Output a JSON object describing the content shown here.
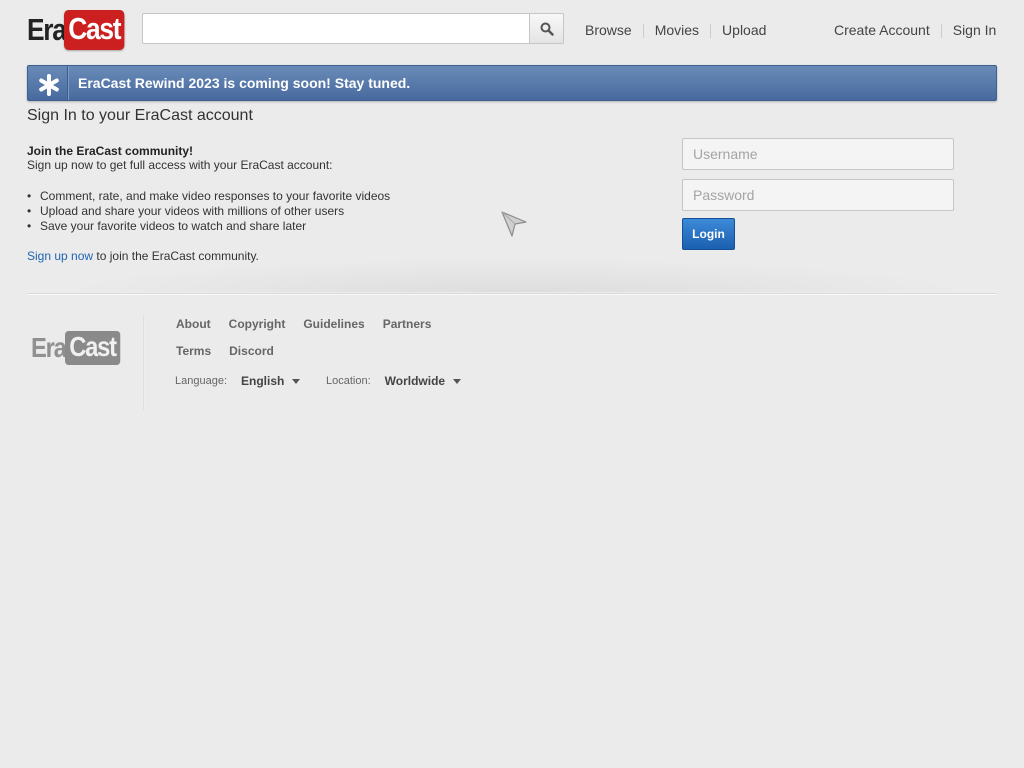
{
  "header": {
    "logo": {
      "part1": "Era",
      "part2": "Cast"
    },
    "search": {
      "value": "",
      "placeholder": "",
      "icon": "search-icon"
    },
    "nav_left": [
      "Browse",
      "Movies",
      "Upload"
    ],
    "nav_right": [
      "Create Account",
      "Sign In"
    ]
  },
  "banner": {
    "icon": "asterisk-icon",
    "text": "EraCast Rewind 2023 is coming soon! Stay tuned.",
    "color": "#4f72a6"
  },
  "main": {
    "title": "Sign In to your EraCast account",
    "join_title": "Join the EraCast community!",
    "join_subtitle": "Sign up now to get full access with your EraCast account:",
    "benefits": [
      "Comment, rate, and make video responses to your favorite videos",
      "Upload and share your videos with millions of other users",
      "Save your favorite videos to watch and share later"
    ],
    "signup_link": "Sign up now",
    "signup_rest": " to join the EraCast community."
  },
  "login": {
    "username_placeholder": "Username",
    "password_placeholder": "Password",
    "button_label": "Login",
    "button_color": "#2a74c6"
  },
  "footer": {
    "logo": {
      "part1": "Era",
      "part2": "Cast"
    },
    "links_row1": [
      "About",
      "Copyright",
      "Guidelines",
      "Partners"
    ],
    "links_row2": [
      "Terms",
      "Discord"
    ],
    "language_label": "Language:",
    "language_value": "English",
    "location_label": "Location:",
    "location_value": "Worldwide"
  }
}
